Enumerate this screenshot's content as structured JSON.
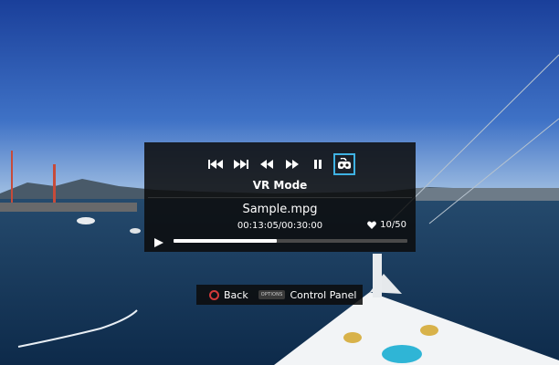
{
  "player": {
    "mode_label": "VR Mode",
    "file_name": "Sample.mpg",
    "time_readout": "00:13:05/00:30:00",
    "like_count": "10/50",
    "progress_fraction": 0.44
  },
  "controls": [
    {
      "name": "skip-previous",
      "icon": "skip-previous-icon"
    },
    {
      "name": "skip-next",
      "icon": "skip-next-icon"
    },
    {
      "name": "rewind",
      "icon": "rewind-icon"
    },
    {
      "name": "fast-forward",
      "icon": "fast-forward-icon"
    },
    {
      "name": "pause",
      "icon": "pause-icon"
    },
    {
      "name": "vr-mode",
      "icon": "vr-headset-icon",
      "selected": true
    }
  ],
  "hints": {
    "back_label": "Back",
    "options_key": "OPTIONS",
    "control_panel_label": "Control Panel"
  },
  "colors": {
    "accent": "#3fb2e3",
    "back_button": "#d23a3a",
    "panel_bg": "#0c0c0c"
  }
}
